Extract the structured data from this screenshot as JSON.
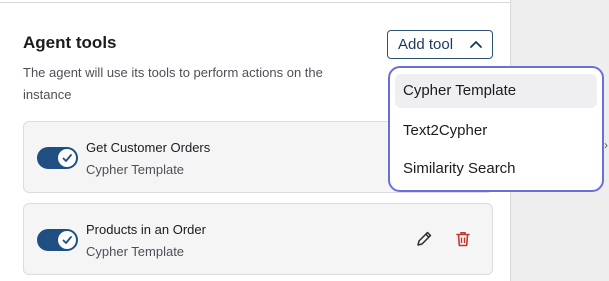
{
  "section": {
    "title": "Agent tools",
    "description": "The agent will use its tools to perform actions on the instance"
  },
  "add_tool": {
    "label": "Add tool",
    "icon": "chevron-up-icon",
    "border_color": "#2d5374"
  },
  "tools": [
    {
      "name": "Get Customer Orders",
      "type": "Cypher Template",
      "enabled": true
    },
    {
      "name": "Products in an Order",
      "type": "Cypher Template",
      "enabled": true
    }
  ],
  "dropdown": {
    "options": [
      "Cypher Template",
      "Text2Cypher",
      "Similarity Search"
    ],
    "highlighted": "Cypher Template",
    "border_color": "#6a6fd8"
  },
  "colors": {
    "toggle_on": "#1f4f82",
    "delete": "#c0392b"
  },
  "icons": {
    "edit": "pencil-icon",
    "delete": "trash-icon",
    "toggle": "check-icon"
  }
}
